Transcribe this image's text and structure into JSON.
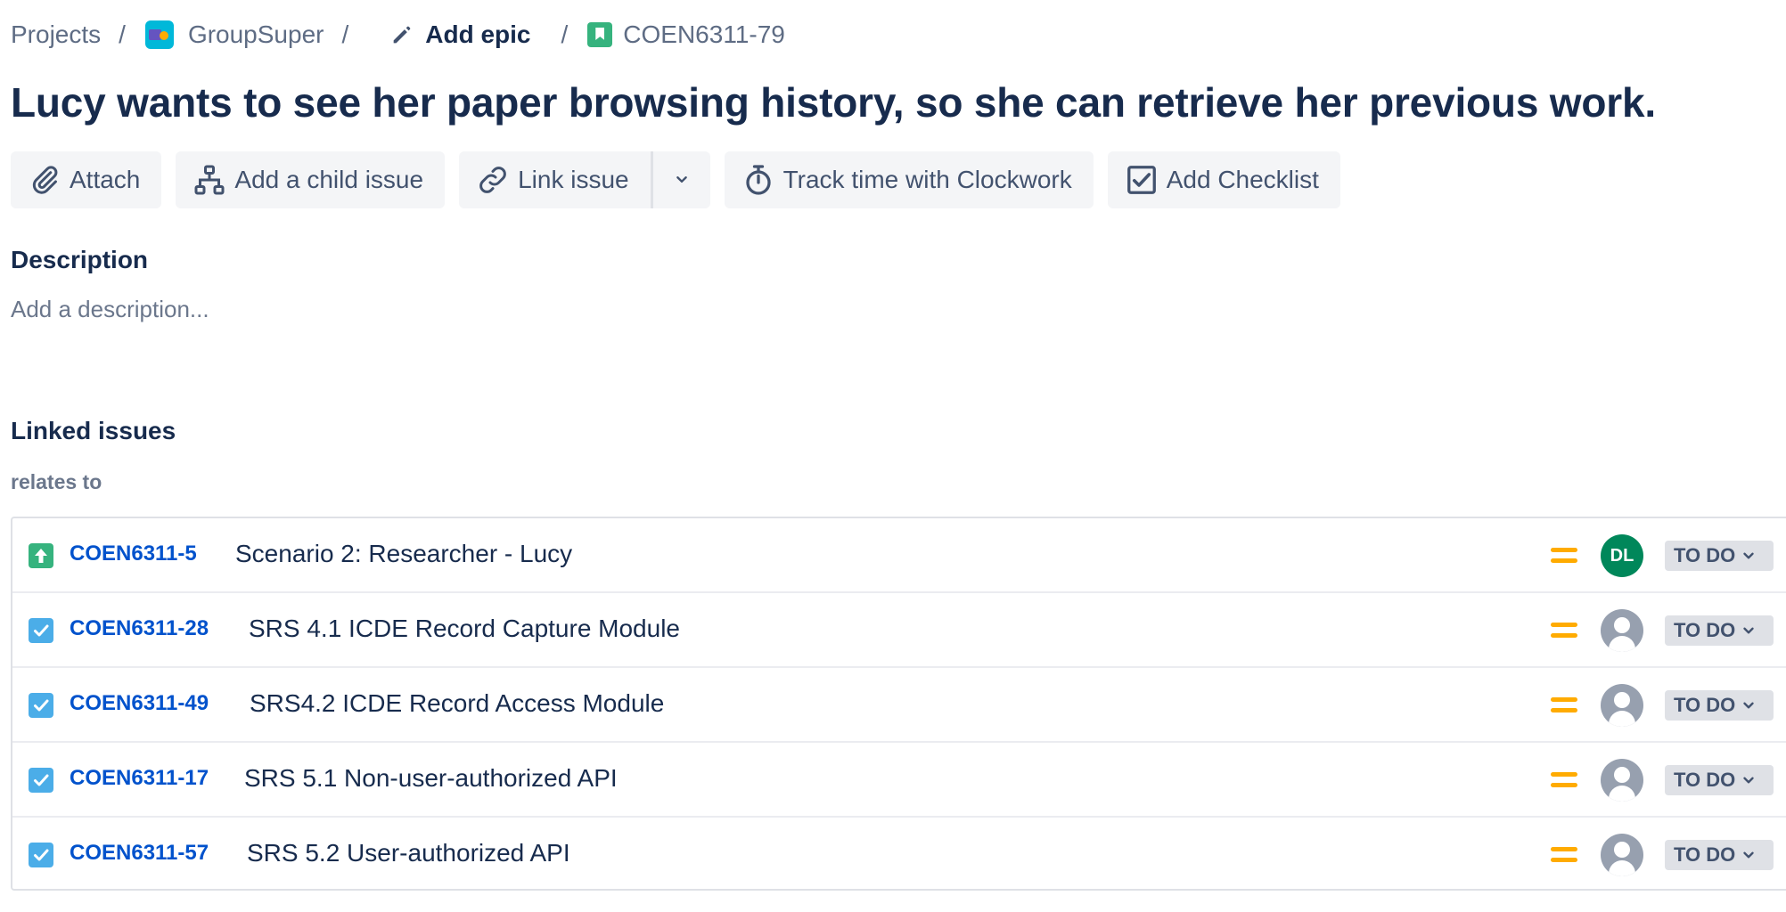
{
  "breadcrumb": {
    "projects": "Projects",
    "separator": "/",
    "project": "GroupSuper",
    "epic": "Add epic",
    "issue_key": "COEN6311-79"
  },
  "issue": {
    "title": "Lucy wants to see her paper browsing history, so she can retrieve her previous work."
  },
  "toolbar": {
    "attach": "Attach",
    "add_child": "Add a child issue",
    "link_issue": "Link issue",
    "track_time": "Track time with Clockwork",
    "add_checklist": "Add Checklist"
  },
  "description": {
    "heading": "Description",
    "placeholder": "Add a description..."
  },
  "linked": {
    "heading": "Linked issues",
    "relation": "relates to",
    "issues": [
      {
        "type_icon": "epic-icon",
        "key": "COEN6311-5",
        "summary": "Scenario 2: Researcher - Lucy",
        "priority": "medium-priority-icon",
        "assignee": "DL",
        "status": "TO DO"
      },
      {
        "type_icon": "task-icon",
        "key": "COEN6311-28",
        "summary": "SRS 4.1 ICDE Record Capture Module",
        "priority": "medium-priority-icon",
        "assignee": "",
        "status": "TO DO"
      },
      {
        "type_icon": "task-icon",
        "key": "COEN6311-49",
        "summary": "SRS4.2 ICDE Record Access Module",
        "priority": "medium-priority-icon",
        "assignee": "",
        "status": "TO DO"
      },
      {
        "type_icon": "task-icon",
        "key": "COEN6311-17",
        "summary": "SRS 5.1 Non-user-authorized API",
        "priority": "medium-priority-icon",
        "assignee": "",
        "status": "TO DO"
      },
      {
        "type_icon": "task-icon",
        "key": "COEN6311-57",
        "summary": "SRS 5.2 User-authorized API",
        "priority": "medium-priority-icon",
        "assignee": "",
        "status": "TO DO"
      }
    ]
  },
  "colors": {
    "link_blue": "#0052cc",
    "text_dark": "#172b4d",
    "priority_medium": "#ffab00",
    "task_blue": "#4bade8",
    "epic_green": "#36b37e",
    "avatar_green": "#00875a"
  }
}
